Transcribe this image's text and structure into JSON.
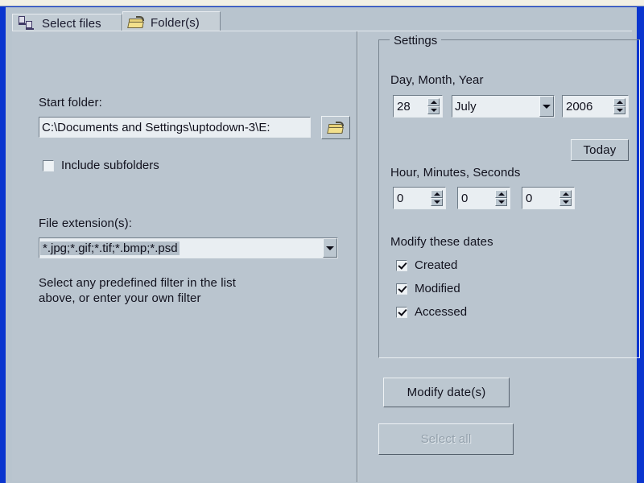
{
  "window": {
    "frame_color": "#0a35cf",
    "panel_bg": "#b8c4ce"
  },
  "tabs": [
    {
      "id": "select-files",
      "label": "Select files",
      "icon": "documents-icon",
      "active": false
    },
    {
      "id": "folders",
      "label": "Folder(s)",
      "icon": "open-folder-icon",
      "active": true
    }
  ],
  "left_panel": {
    "start_folder_label": "Start folder:",
    "start_folder_value": "C:\\Documents and Settings\\uptodown-3\\E:",
    "browse_icon": "open-folder-browse-icon",
    "include_subfolders_label": "Include subfolders",
    "include_subfolders_checked": false,
    "file_extensions_label": "File extension(s):",
    "file_extensions_value": "*.jpg;*.gif;*.tif;*.bmp;*.psd",
    "filter_hint": "Select any predefined filter in the list above, or enter your own filter"
  },
  "settings": {
    "legend": "Settings",
    "date_label": "Day, Month, Year",
    "day": "28",
    "month": "July",
    "year": "2006",
    "today_label": "Today",
    "time_label": "Hour, Minutes, Seconds",
    "hour": "0",
    "minutes": "0",
    "seconds": "0",
    "modify_dates_label": "Modify these dates",
    "checkboxes": [
      {
        "label": "Created",
        "checked": true
      },
      {
        "label": "Modified",
        "checked": true
      },
      {
        "label": "Accessed",
        "checked": true
      }
    ]
  },
  "actions": {
    "modify_dates_label": "Modify date(s)",
    "modify_dates_enabled": true,
    "select_all_label": "Select all",
    "select_all_enabled": false
  }
}
